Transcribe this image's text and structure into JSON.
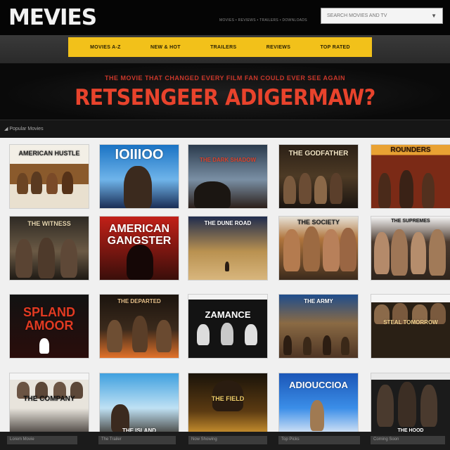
{
  "header": {
    "logo": "MEVIES",
    "tagline": "MOVIES • REVIEWS • TRAILERS • DOWNLOADS",
    "search_placeholder": "SEARCH MOVIES AND TV",
    "search_caret": "▼"
  },
  "nav": [
    "MOVIES A-Z",
    "NEW & HOT",
    "TRAILERS",
    "REVIEWS",
    "TOP RATED"
  ],
  "hero": {
    "kicker": "THE MOVIE THAT CHANGED EVERY FILM FAN COULD EVER SEE AGAIN",
    "title": "RETSENGEER ADIGERMAW?"
  },
  "section": {
    "crumb": "◢ Popular Movies"
  },
  "posters": [
    {
      "title": "AMERICAN HUSTLE"
    },
    {
      "title": "IOIIIOO"
    },
    {
      "title": "THE DARK SHADOW"
    },
    {
      "title": "THE GODFATHER"
    },
    {
      "title": "ROUNDERS"
    },
    {
      "title": "THE WITNESS"
    },
    {
      "title": "AMERICAN GANGSTER"
    },
    {
      "title": "THE DUNE ROAD"
    },
    {
      "title": "THE SOCIETY"
    },
    {
      "title": "THE SUPREMES"
    },
    {
      "title": "SPLAND AMOOR"
    },
    {
      "title": "THE DEPARTED"
    },
    {
      "title": "ZAMANCE"
    },
    {
      "title": "THE ARMY"
    },
    {
      "title": "STEAL TOMORROW"
    },
    {
      "title": "THE COMPANY"
    },
    {
      "title": "THE ISLAND"
    },
    {
      "title": "THE FIELD"
    },
    {
      "title": "ADIOUCCIOA"
    },
    {
      "title": "THE HOOD"
    }
  ],
  "footer": [
    "Lorem Movie",
    "The Trailer",
    "Now Showing",
    "Top Picks",
    "Coming Soon"
  ]
}
